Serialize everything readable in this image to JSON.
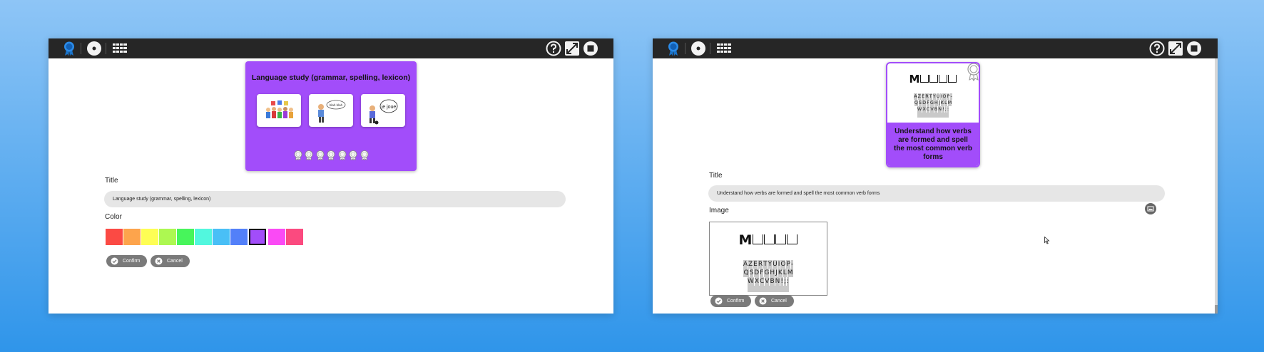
{
  "colors": {
    "accent_purple": "#a24dfa",
    "topbar": "#262626",
    "field_bg": "#e6e6e6",
    "button_bg": "#7a7a7a"
  },
  "topbar": {
    "icons_left": [
      "award-icon",
      "disc-icon",
      "grid-icon"
    ],
    "icons_right": [
      "help-icon",
      "expand-icon",
      "stop-icon"
    ]
  },
  "left_window": {
    "card": {
      "title": "Language study (grammar, spelling, lexicon)",
      "thumbnails": [
        "people-icon",
        "speaking-man-icon",
        "je-joue-icon"
      ],
      "thumbnail_bubbles": {
        "speaking": "blah blah",
        "je_joue": "je joue"
      },
      "progress_medal_count": 7
    },
    "title_label": "Title",
    "title_value": "Language study (grammar, spelling, lexicon)",
    "color_label": "Color",
    "palette": [
      "#fb4a44",
      "#fda44c",
      "#fefe54",
      "#adf851",
      "#47f55b",
      "#52f7de",
      "#49bff6",
      "#5380f9",
      "#a24dfa",
      "#fa4af5",
      "#fb4a7f"
    ],
    "selected_color": "#a24dfa",
    "confirm_label": "Confirm",
    "cancel_label": "Cancel"
  },
  "right_window": {
    "card": {
      "word_letter": "M",
      "keyboard_rows": [
        [
          "A",
          "Z",
          "E",
          "R",
          "T",
          "Y",
          "U",
          "I",
          "O",
          "P",
          "-"
        ],
        [
          "Q",
          "S",
          "D",
          "F",
          "G",
          "H",
          "J",
          "K",
          "L",
          "M"
        ],
        [
          "W",
          "X",
          "C",
          "V",
          "B",
          "N",
          "!",
          ";",
          ":"
        ]
      ],
      "title": "Understand how verbs are formed and spell the most common verb forms"
    },
    "title_label": "Title",
    "title_value": "Understand how verbs are formed and spell the most common verb forms",
    "image_label": "Image",
    "image_action_icon": "change-image-icon",
    "confirm_label": "Confirm",
    "cancel_label": "Cancel"
  }
}
